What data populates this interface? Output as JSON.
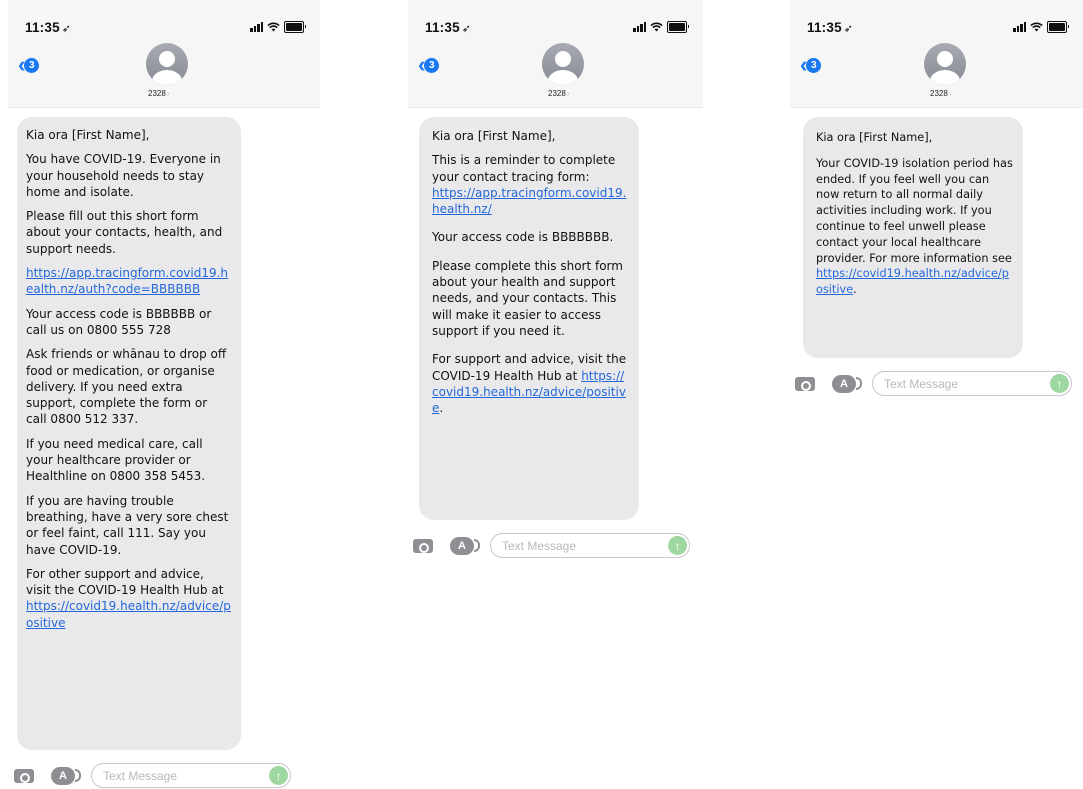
{
  "screens": [
    {
      "status": {
        "time": "11:35",
        "location_glyph": "➶"
      },
      "header": {
        "back_count": "3",
        "contact": "2328"
      },
      "input": {
        "placeholder": "Text Message"
      },
      "message": [
        {
          "text": "Kia ora [First Name],"
        },
        {
          "text": "You have COVID-19. Everyone in your household needs to stay home and isolate."
        },
        {
          "text": "Please fill out this short form about your contacts, health, and support needs."
        },
        {
          "link": "https://app.tracingform.covid19.health.nz/auth?code=BBBBBB"
        },
        {
          "text": "Your access code is BBBBBB or call us on 0800 555 728"
        },
        {
          "text": "Ask friends or whānau to drop off food or medication, or organise delivery. If you need extra support, complete the form or call 0800 512 337."
        },
        {
          "text": "If you need medical care, call your healthcare provider or Healthline on 0800 358 5453."
        },
        {
          "text": "If you are having trouble breathing, have a very sore chest or feel faint, call 111.  Say you have COVID-19."
        },
        {
          "text": "For other support and advice, visit the COVID-19 Health Hub at",
          "link": "https://covid19.health.nz/advice/positive"
        }
      ]
    },
    {
      "status": {
        "time": "11:35",
        "location_glyph": "➶"
      },
      "header": {
        "back_count": "3",
        "contact": "2328"
      },
      "input": {
        "placeholder": "Text Message"
      },
      "message": [
        {
          "text": "Kia ora [First Name],"
        },
        {
          "text": "This is a reminder to complete your contact tracing form:",
          "link": "https://app.tracingform.covid19.health.nz/"
        },
        {
          "text": "Your access code is BBBBBBB."
        },
        {
          "text": "Please complete this short form about your health and support needs, and your contacts. This will make it easier to access support if you need it."
        },
        {
          "text": "For support and advice, visit the COVID-19 Health Hub at",
          "link": "https://covid19.health.nz/advice/positive",
          "suffix": "."
        }
      ]
    },
    {
      "status": {
        "time": "11:35",
        "location_glyph": "➶"
      },
      "header": {
        "back_count": "3",
        "contact": "2328"
      },
      "input": {
        "placeholder": "Text Message"
      },
      "message": [
        {
          "text": "Kia ora [First Name],"
        },
        {
          "text": "Your COVID-19 isolation period has ended. If you feel well you can now return to all normal daily activities including work. If you continue to feel unwell please contact your local healthcare provider. For more information see",
          "link": "https://covid19.health.nz/advice/positive",
          "suffix": "."
        }
      ]
    }
  ],
  "colors": {
    "link": "#2468d9",
    "badge": "#1a78f2",
    "bubble": "#e9e9eb",
    "send": "#9fd7a2"
  },
  "icons": [
    "signal-icon",
    "wifi-icon",
    "battery-icon",
    "back-chevron-icon",
    "avatar-icon",
    "camera-icon",
    "app-store-icon",
    "send-arrow-icon"
  ]
}
